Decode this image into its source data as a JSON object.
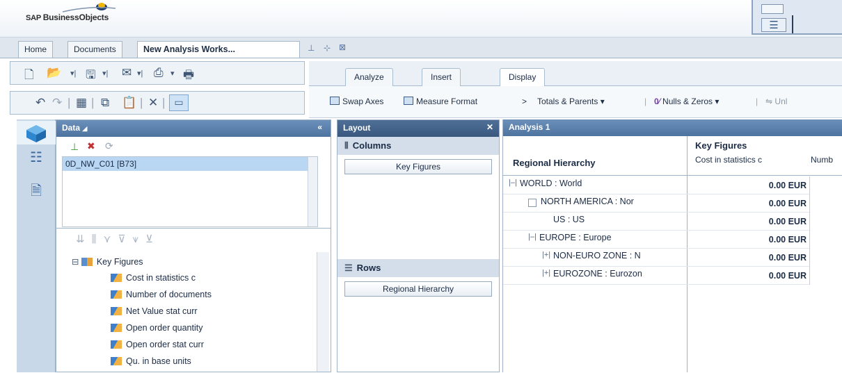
{
  "app": {
    "logo_prefix": "SAP ",
    "logo_main": "BusinessObjects"
  },
  "tabs": [
    {
      "label": "Home"
    },
    {
      "label": "Documents"
    },
    {
      "label": "New Analysis Works..."
    }
  ],
  "ribbon": {
    "tabs": [
      "Analyze",
      "Insert",
      "Display"
    ],
    "active_tab": "Display",
    "items": {
      "swap_axes": "Swap Axes",
      "measure_format": "Measure Format",
      "totals_parents": "Totals & Parents",
      "nulls_zeros": "Nulls & Zeros",
      "unl": "Unl"
    }
  },
  "data_panel": {
    "title": "Data",
    "source": "0D_NW_C01 [B73]",
    "tree_root": "Key Figures",
    "measures": [
      "Cost in statistics c",
      "Number of documents",
      "Net Value stat curr",
      "Open order quantity",
      "Open order stat curr",
      "Qu. in base units"
    ]
  },
  "layout_panel": {
    "title": "Layout",
    "columns_label": "Columns",
    "columns_field": "Key Figures",
    "rows_label": "Rows",
    "rows_field": "Regional Hierarchy"
  },
  "analysis": {
    "title": "Analysis 1",
    "row_header": "Regional Hierarchy",
    "col_group": "Key Figures",
    "col_headers": [
      "Cost in statistics c",
      "Numb"
    ],
    "rows": [
      {
        "toggle": "|–|",
        "label": "WORLD : World",
        "value": "0.00 EUR"
      },
      {
        "toggle": "",
        "label": "NORTH AMERICA : Nor",
        "value": "0.00 EUR"
      },
      {
        "toggle": "",
        "label": "US : US",
        "value": "0.00 EUR"
      },
      {
        "toggle": "|–|",
        "label": "EUROPE : Europe",
        "value": "0.00 EUR"
      },
      {
        "toggle": "|+|",
        "label": "NON-EURO ZONE : N",
        "value": "0.00 EUR"
      },
      {
        "toggle": "|+|",
        "label": "EUROZONE : Eurozon",
        "value": "0.00 EUR"
      }
    ]
  }
}
